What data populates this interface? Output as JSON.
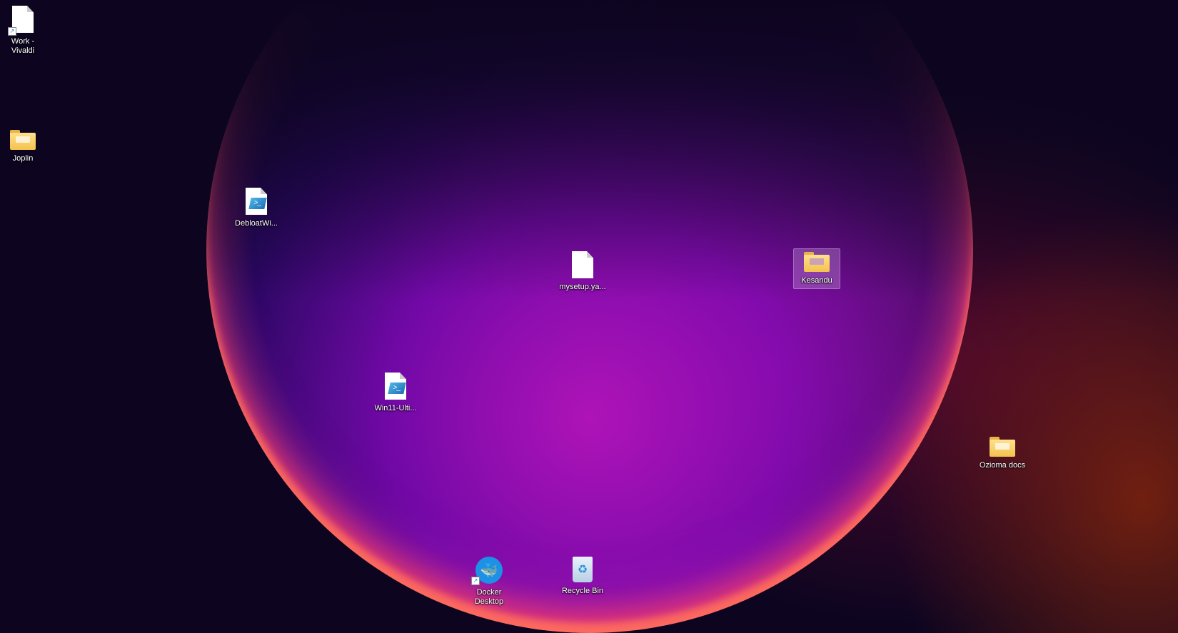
{
  "desktop": {
    "icons": [
      {
        "label": "Work - Vivaldi",
        "type": "file-shortcut-icon"
      },
      {
        "label": "Joplin",
        "type": "folder-icon"
      },
      {
        "label": "DebloatWi...",
        "type": "powershell-script-icon"
      },
      {
        "label": "mysetup.ya...",
        "type": "file-icon"
      },
      {
        "label": "Kesandu",
        "type": "folder-icon"
      },
      {
        "label": "Win11-Ulti...",
        "type": "powershell-script-icon"
      },
      {
        "label": "Ozioma docs",
        "type": "folder-icon"
      },
      {
        "label": "Docker Desktop",
        "type": "docker-icon"
      },
      {
        "label": "Recycle Bin",
        "type": "recycle-bin-icon"
      }
    ],
    "selected": "Kesandu"
  }
}
